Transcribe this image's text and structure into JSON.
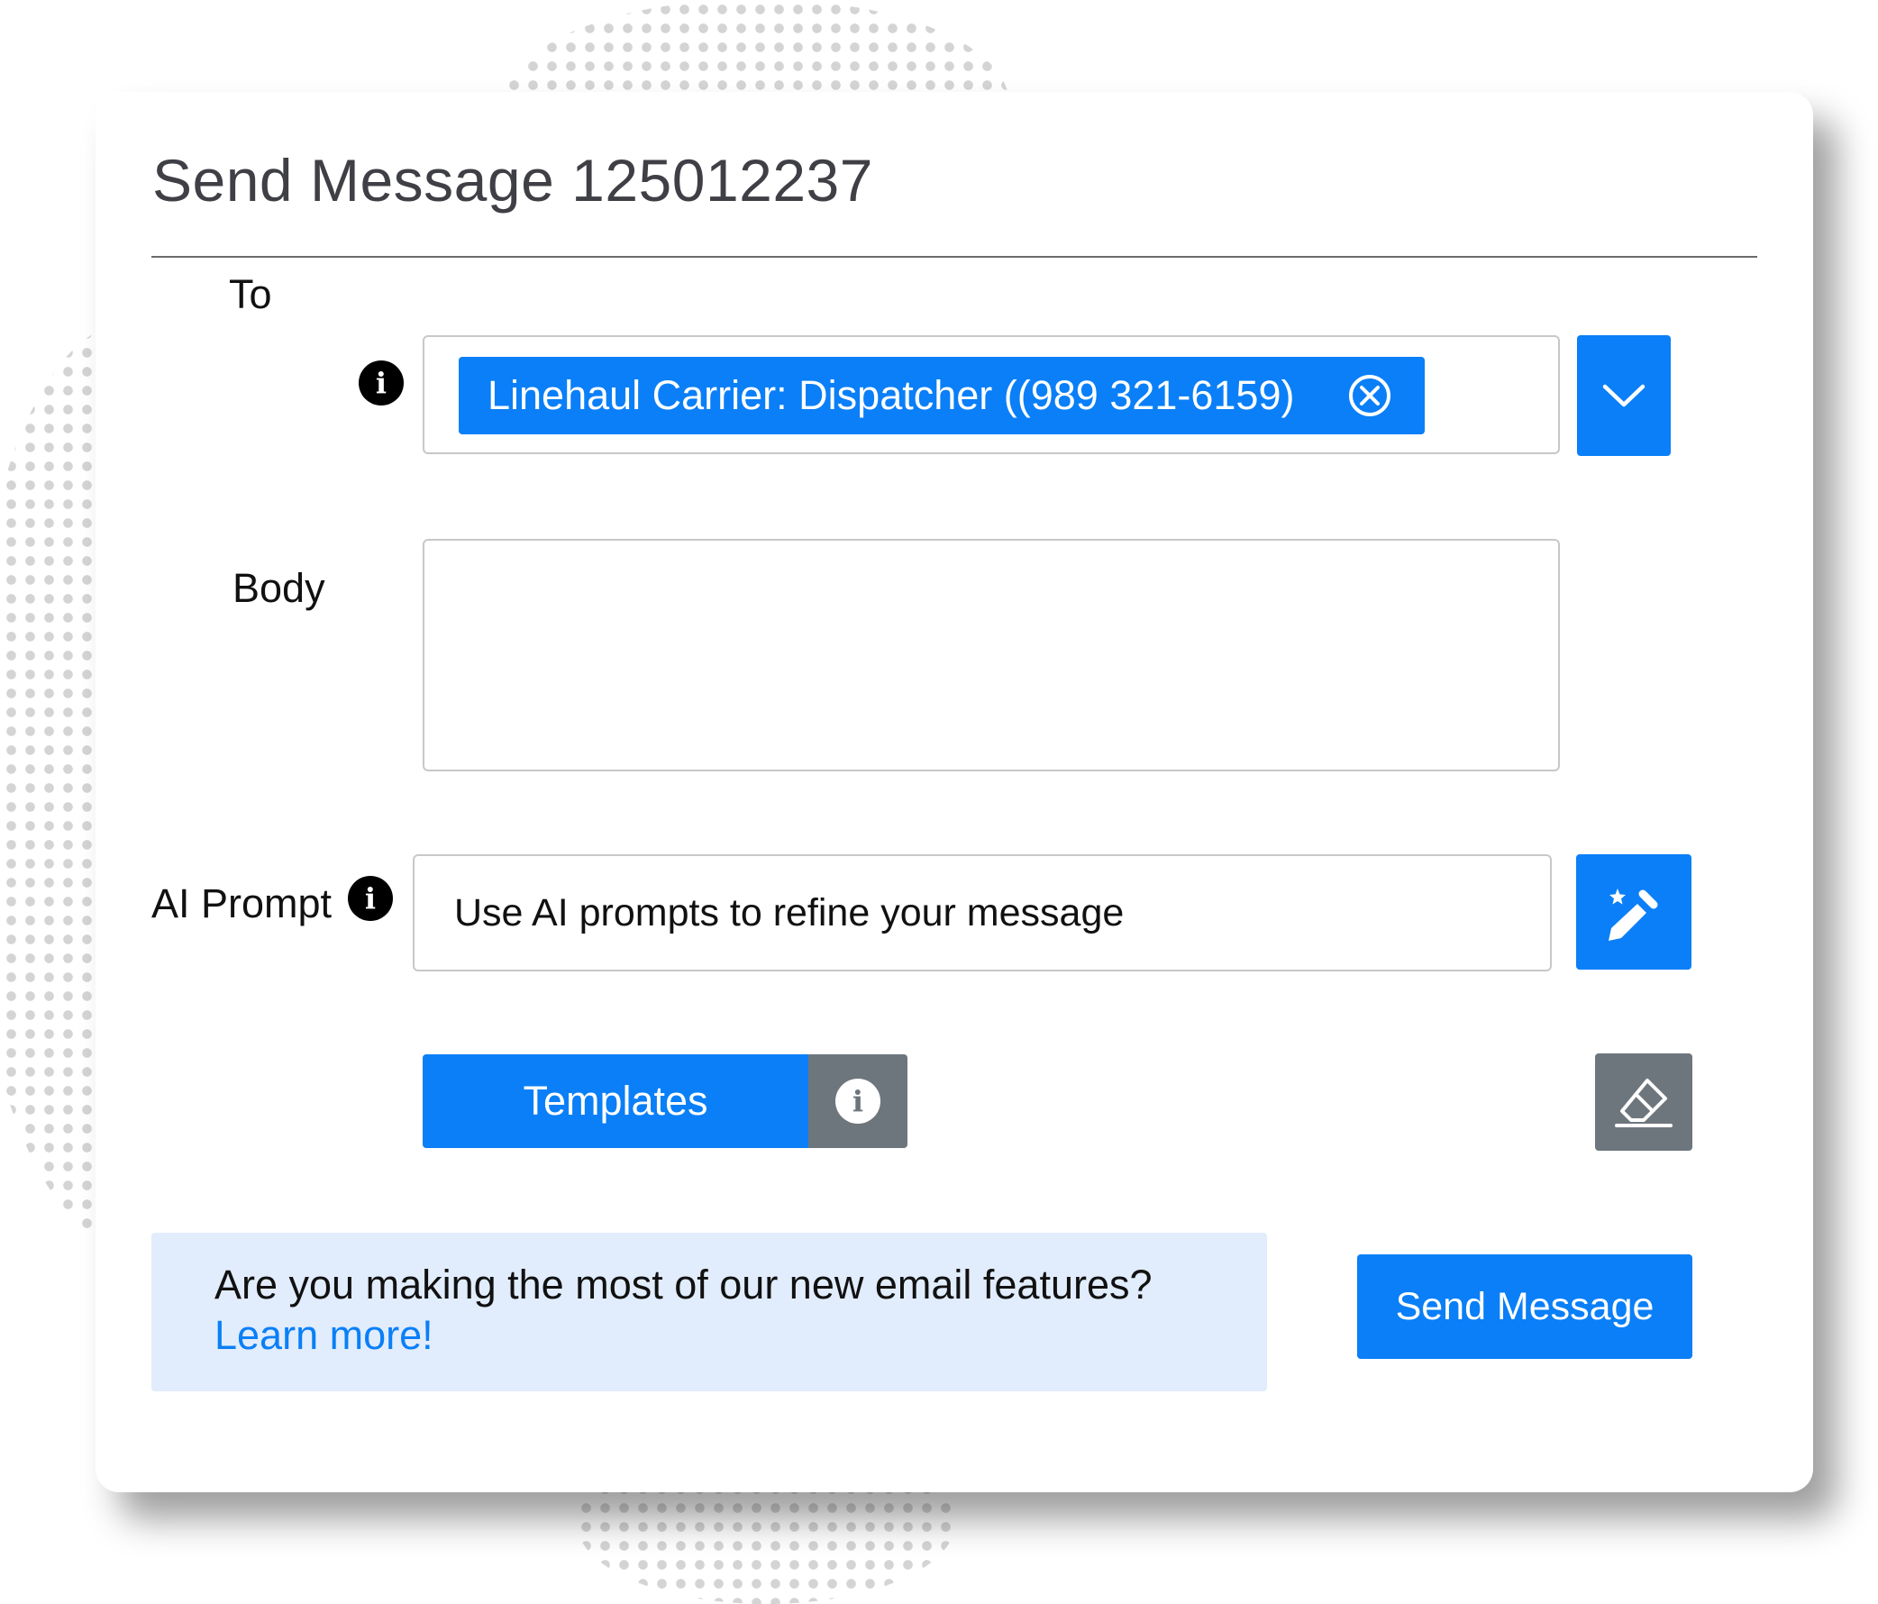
{
  "dialog": {
    "title": "Send Message 125012237"
  },
  "to": {
    "label": "To",
    "info_icon": "info-icon",
    "recipient_chip": "Linehaul Carrier: Dispatcher ((989 321-6159)",
    "chip_remove_icon": "close-circle-icon",
    "dropdown_icon": "chevron-down-icon"
  },
  "body": {
    "label": "Body",
    "value": ""
  },
  "ai_prompt": {
    "label": "AI Prompt",
    "info_icon": "info-icon",
    "placeholder": "Use AI prompts to refine your message",
    "button_icon": "magic-pencil-icon"
  },
  "templates": {
    "label": "Templates",
    "info_icon": "info-icon"
  },
  "clear": {
    "icon": "eraser-icon"
  },
  "promo": {
    "text": "Are you making the most of our new email features?",
    "link": "Learn more!"
  },
  "send": {
    "label": "Send Message"
  },
  "colors": {
    "primary": "#0a7ff7",
    "secondary": "#6e767d",
    "promo_bg": "#e1ecfc",
    "title": "#3f3f46"
  }
}
